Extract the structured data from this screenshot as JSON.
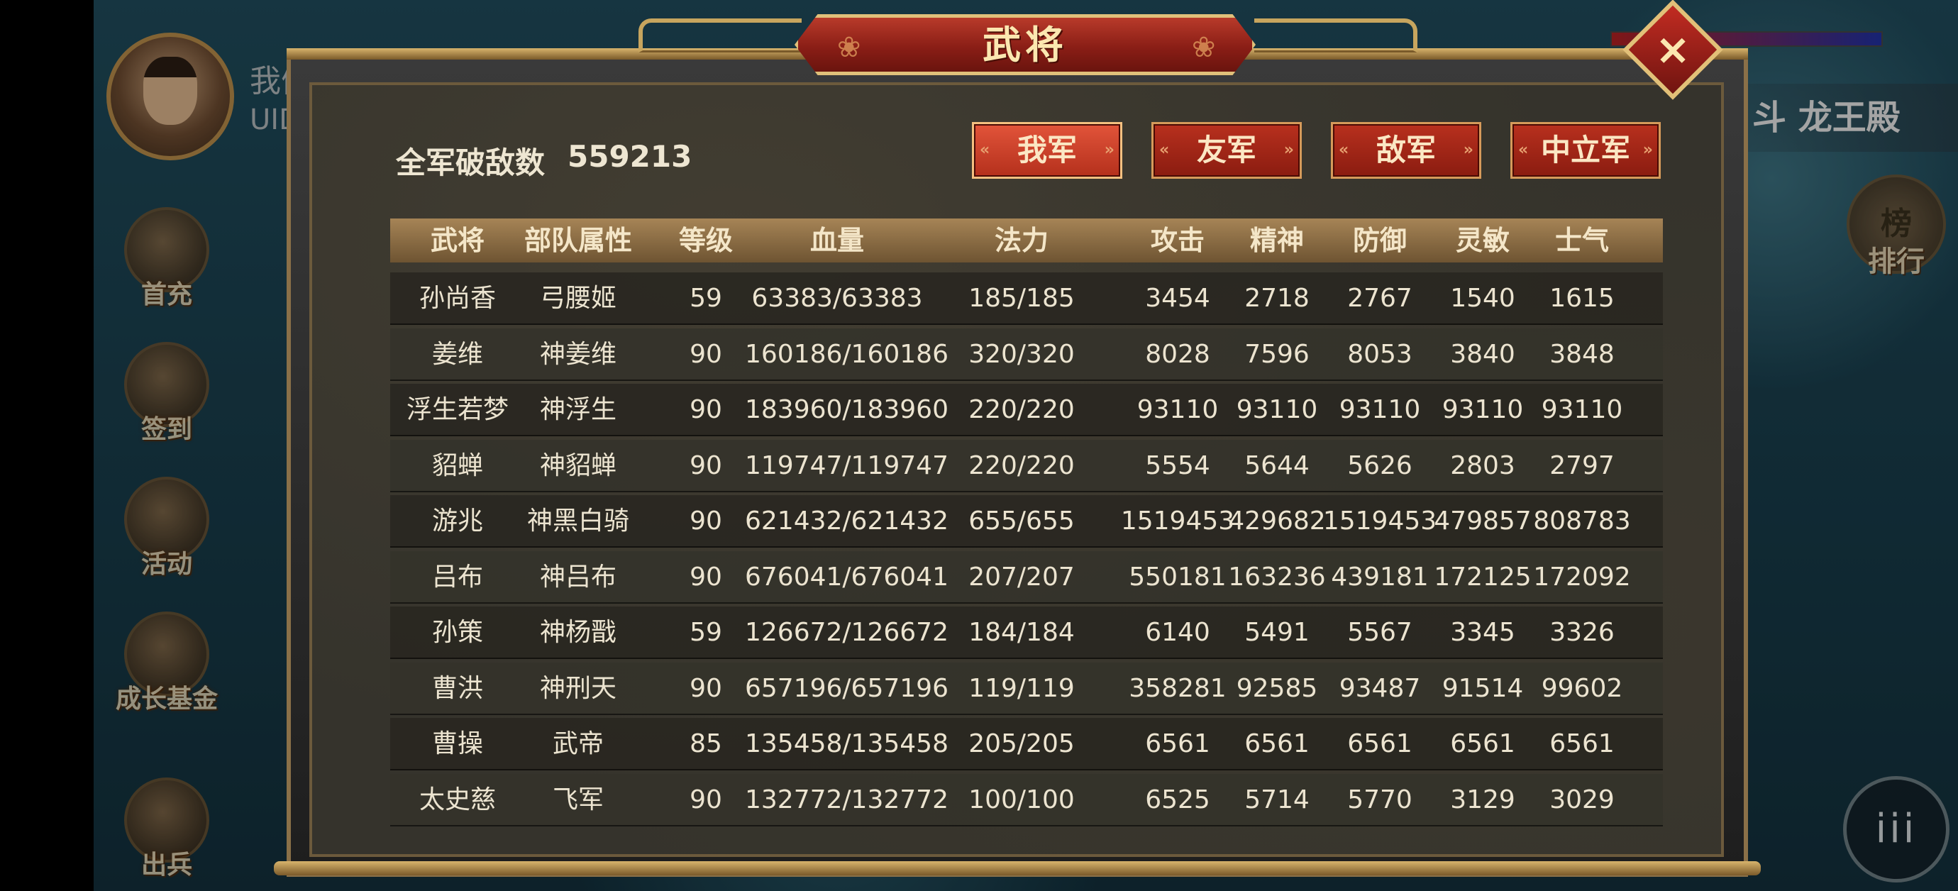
{
  "hud": {
    "player_name_partial": "我们",
    "uid_label": "UID",
    "area_name": "斗 龙王殿",
    "side_buttons": [
      "首充",
      "签到",
      "活动",
      "成长基金",
      "出兵"
    ],
    "rank_icon_text": "榜",
    "rank_label": "排行",
    "menu_icon": "iii"
  },
  "dialog": {
    "title": "武将",
    "close_icon": "×",
    "kill_label": "全军破敌数",
    "kill_value": "559213",
    "tabs": [
      "我军",
      "友军",
      "敌军",
      "中立军"
    ],
    "active_tab": 0,
    "headers": [
      "武将",
      "部队属性",
      "等级",
      "血量",
      "法力",
      "攻击",
      "精神",
      "防御",
      "灵敏",
      "士气"
    ],
    "rows": [
      [
        "孙尚香",
        "弓腰姬",
        "59",
        "63383/63383",
        "185/185",
        "3454",
        "2718",
        "2767",
        "1540",
        "1615"
      ],
      [
        "姜维",
        "神姜维",
        "90",
        "160186/160186",
        "320/320",
        "8028",
        "7596",
        "8053",
        "3840",
        "3848"
      ],
      [
        "浮生若梦",
        "神浮生",
        "90",
        "183960/183960",
        "220/220",
        "93110",
        "93110",
        "93110",
        "93110",
        "93110"
      ],
      [
        "貂蝉",
        "神貂蝉",
        "90",
        "119747/119747",
        "220/220",
        "5554",
        "5644",
        "5626",
        "2803",
        "2797"
      ],
      [
        "游兆",
        "神黑白骑",
        "90",
        "621432/621432",
        "655/655",
        "1519453",
        "429682",
        "1519453",
        "479857",
        "808783"
      ],
      [
        "吕布",
        "神吕布",
        "90",
        "676041/676041",
        "207/207",
        "550181",
        "163236",
        "439181",
        "172125",
        "172092"
      ],
      [
        "孙策",
        "神杨戬",
        "59",
        "126672/126672",
        "184/184",
        "6140",
        "5491",
        "5567",
        "3345",
        "3326"
      ],
      [
        "曹洪",
        "神刑天",
        "90",
        "657196/657196",
        "119/119",
        "358281",
        "92585",
        "93487",
        "91514",
        "99602"
      ],
      [
        "曹操",
        "武帝",
        "85",
        "135458/135458",
        "205/205",
        "6561",
        "6561",
        "6561",
        "6561",
        "6561"
      ],
      [
        "太史慈",
        "飞军",
        "90",
        "132772/132772",
        "100/100",
        "6525",
        "5714",
        "5770",
        "3129",
        "3029"
      ]
    ]
  }
}
